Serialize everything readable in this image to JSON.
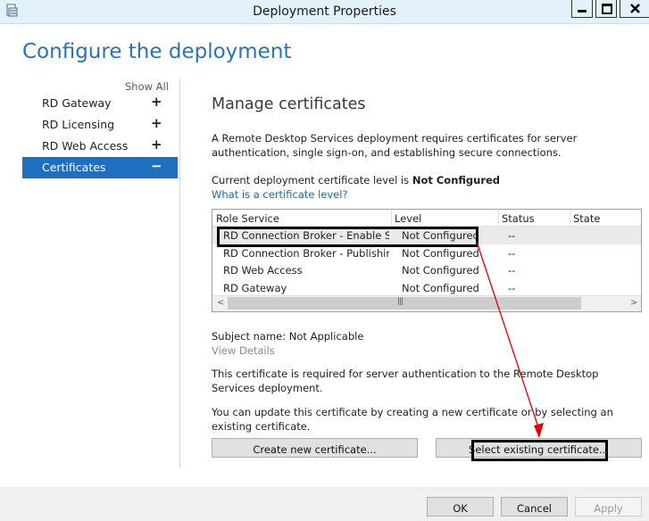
{
  "window": {
    "title": "Deployment Properties"
  },
  "page": {
    "heading": "Configure the deployment",
    "show_all": "Show All"
  },
  "nav": {
    "items": [
      {
        "label": "RD Gateway",
        "sign": "+"
      },
      {
        "label": "RD Licensing",
        "sign": "+"
      },
      {
        "label": "RD Web Access",
        "sign": "+"
      },
      {
        "label": "Certificates",
        "sign": "−"
      }
    ],
    "active_index": 3
  },
  "section": {
    "title": "Manage certificates",
    "description": "A Remote Desktop Services deployment requires certificates for server authentication, single sign-on, and establishing secure connections.",
    "level_prefix": "Current deployment certificate level is ",
    "level_value": "Not Configured",
    "level_link": "What is a certificate level?"
  },
  "grid": {
    "columns": [
      "Role Service",
      "Level",
      "Status",
      "State"
    ],
    "rows": [
      {
        "role": "RD Connection Broker - Enable Single Sign On",
        "level": "Not Configured",
        "status": "--",
        "state": ""
      },
      {
        "role": "RD Connection Broker - Publishing",
        "level": "Not Configured",
        "status": "--",
        "state": ""
      },
      {
        "role": "RD Web Access",
        "level": "Not Configured",
        "status": "--",
        "state": ""
      },
      {
        "role": "RD Gateway",
        "level": "Not Configured",
        "status": "--",
        "state": ""
      }
    ],
    "scroll_left": "<",
    "scroll_right": ">",
    "scroll_grip": "|||"
  },
  "details": {
    "subject": "Subject name: Not Applicable",
    "view_details": "View Details",
    "required_text": "This certificate is required for server authentication to the Remote Desktop Services deployment.",
    "update_text": "You can update this certificate by creating a new certificate or by selecting an existing certificate."
  },
  "buttons": {
    "create": "Create new certificate...",
    "select": "Select existing certificate...",
    "ok": "OK",
    "cancel": "Cancel",
    "apply": "Apply"
  },
  "colors": {
    "accent": "#1f6fc1",
    "heading": "#2a74b5",
    "link": "#1b67b2",
    "annotation_arrow": "#e00000"
  }
}
